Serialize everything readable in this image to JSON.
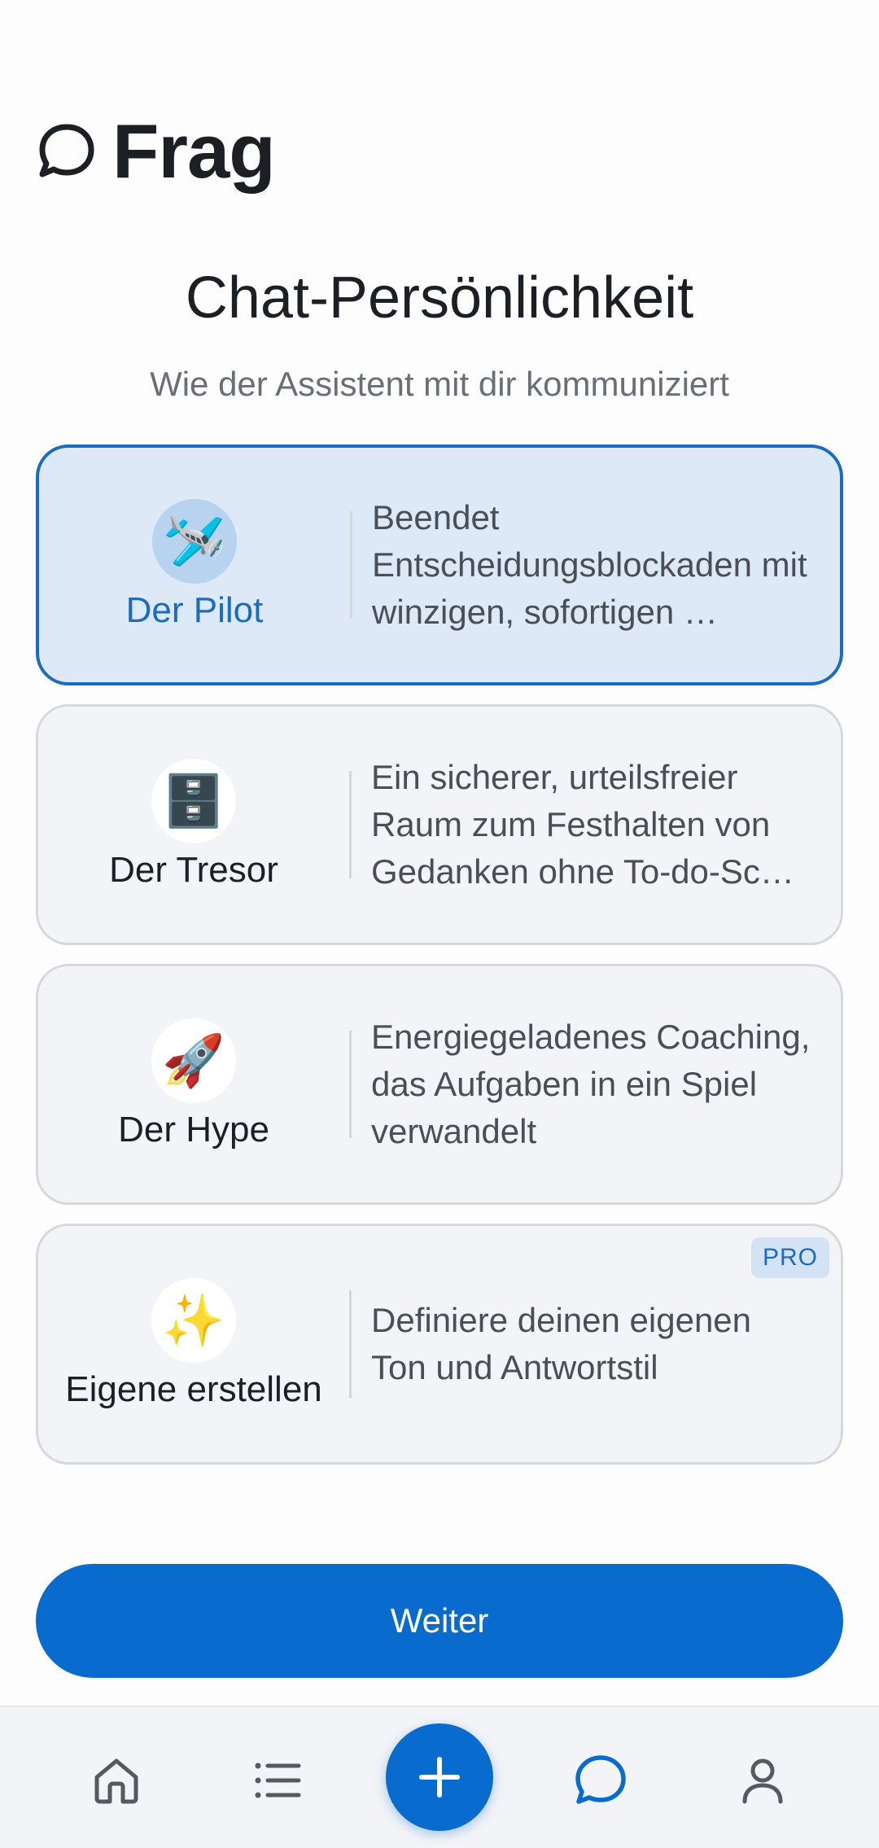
{
  "header": {
    "title": "Frag",
    "icon": "chat-bubble-icon"
  },
  "section": {
    "title": "Chat-Persönlichkeit",
    "subtitle": "Wie der Assistent mit dir kommuniziert"
  },
  "personalities": [
    {
      "name": "Der Pilot",
      "emoji": "🛩️",
      "icon": "airplane-icon",
      "description": "Beendet Entscheidungsblockaden mit winzigen, sofortigen …",
      "selected": true
    },
    {
      "name": "Der Tresor",
      "emoji": "🗄️",
      "icon": "file-cabinet-icon",
      "description": "Ein sicherer, urteilsfreier Raum zum Festhalten von Gedanken ohne To-do-Sc…",
      "selected": false
    },
    {
      "name": "Der Hype",
      "emoji": "🚀",
      "icon": "rocket-icon",
      "description": "Energiegeladenes Coaching, das Aufgaben in ein Spiel verwandelt",
      "selected": false
    },
    {
      "name": "Eigene erstellen",
      "emoji": "✨",
      "icon": "sparkles-icon",
      "description": "Definiere deinen eigenen Ton und Antwortstil",
      "selected": false,
      "badge": "PRO"
    }
  ],
  "continue_label": "Weiter",
  "tabbar": {
    "items": [
      {
        "icon": "home-icon",
        "active": false
      },
      {
        "icon": "list-icon",
        "active": false
      },
      {
        "icon": "plus-icon",
        "active": false
      },
      {
        "icon": "chat-icon",
        "active": true
      },
      {
        "icon": "profile-icon",
        "active": false
      }
    ]
  },
  "colors": {
    "accent": "#0a6bce",
    "selected_bg": "#dde9f7",
    "card_bg": "#f3f4f7",
    "text": "#1c1f24"
  }
}
